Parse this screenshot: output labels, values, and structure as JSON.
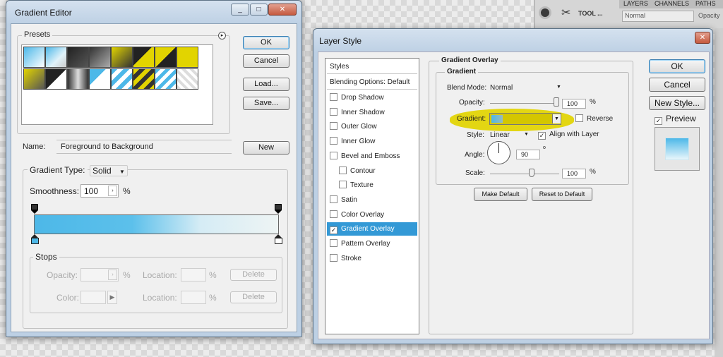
{
  "gradient_editor": {
    "title": "Gradient Editor",
    "presets_label": "Presets",
    "buttons": {
      "ok": "OK",
      "cancel": "Cancel",
      "load": "Load...",
      "save": "Save...",
      "new": "New"
    },
    "name_label": "Name:",
    "name_value": "Foreground to Background",
    "gradient_type_label": "Gradient Type:",
    "gradient_type_value": "Solid",
    "smoothness_label": "Smoothness:",
    "smoothness_value": "100",
    "smoothness_unit": "%",
    "stops": {
      "label": "Stops",
      "opacity_label": "Opacity:",
      "opacity_unit": "%",
      "location_label": "Location:",
      "location_unit": "%",
      "color_label": "Color:",
      "delete_label": "Delete"
    }
  },
  "layer_style": {
    "title": "Layer Style",
    "styles_header": "Styles",
    "blending_options": "Blending Options: Default",
    "style_items": [
      {
        "label": "Drop Shadow",
        "checked": false
      },
      {
        "label": "Inner Shadow",
        "checked": false
      },
      {
        "label": "Outer Glow",
        "checked": false
      },
      {
        "label": "Inner Glow",
        "checked": false
      },
      {
        "label": "Bevel and Emboss",
        "checked": false
      },
      {
        "label": "Contour",
        "checked": false,
        "sub": true
      },
      {
        "label": "Texture",
        "checked": false,
        "sub": true
      },
      {
        "label": "Satin",
        "checked": false
      },
      {
        "label": "Color Overlay",
        "checked": false
      },
      {
        "label": "Gradient Overlay",
        "checked": true,
        "selected": true
      },
      {
        "label": "Pattern Overlay",
        "checked": false
      },
      {
        "label": "Stroke",
        "checked": false
      }
    ],
    "section_title": "Gradient Overlay",
    "group_title": "Gradient",
    "blend_mode_label": "Blend Mode:",
    "blend_mode_value": "Normal",
    "opacity_label": "Opacity:",
    "opacity_value": "100",
    "opacity_fraction": 1.0,
    "gradient_label": "Gradient:",
    "reverse_label": "Reverse",
    "style_label": "Style:",
    "style_value": "Linear",
    "align_label": "Align with Layer",
    "angle_label": "Angle:",
    "angle_value": "90",
    "degree_symbol": "o",
    "scale_label": "Scale:",
    "scale_value": "100",
    "scale_fraction": 0.6,
    "percent": "%",
    "make_default": "Make Default",
    "reset_default": "Reset to Default",
    "buttons": {
      "ok": "OK",
      "cancel": "Cancel",
      "new_style": "New Style..."
    },
    "preview_label": "Preview"
  },
  "background_ui": {
    "tool_label": "TOOL ...",
    "tabs": [
      "LAYERS",
      "CHANNELS",
      "PATHS"
    ],
    "blend_value": "Normal",
    "opacity_label": "Opacity"
  },
  "colors": {
    "accent_blue": "#3399d6",
    "gradient_cyan": "#4db8e8",
    "highlight_yellow": "#e2d400"
  }
}
